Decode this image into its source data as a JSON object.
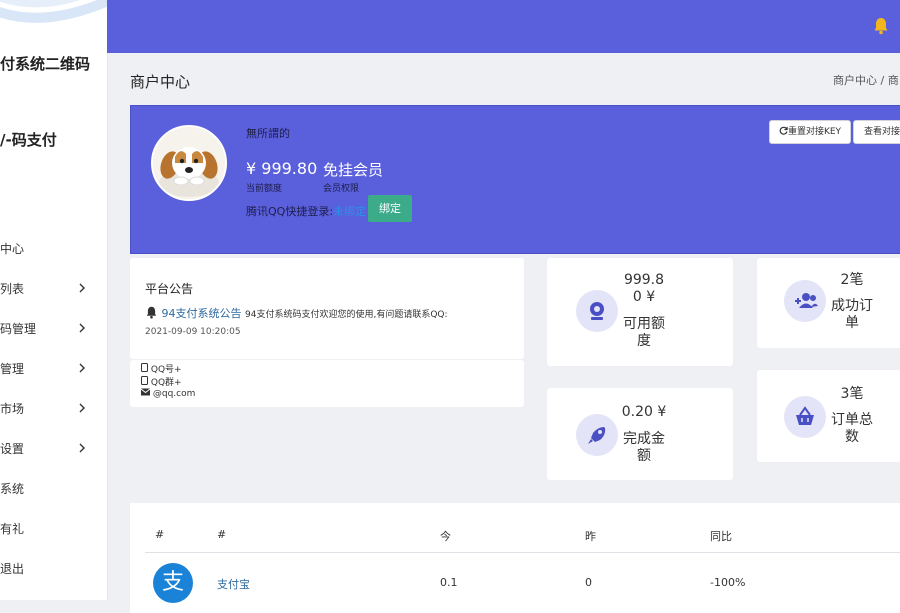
{
  "sidebar": {
    "brand_line1": "付系统二维码",
    "brand_line2": "/-码支付",
    "items": [
      {
        "label": "中心",
        "chevron": false
      },
      {
        "label": "列表",
        "chevron": true
      },
      {
        "label": "码管理",
        "chevron": true
      },
      {
        "label": "管理",
        "chevron": true
      },
      {
        "label": "市场",
        "chevron": true
      },
      {
        "label": "设置",
        "chevron": true
      },
      {
        "label": "系统",
        "chevron": false
      },
      {
        "label": "有礼",
        "chevron": false
      },
      {
        "label": "退出",
        "chevron": false
      }
    ]
  },
  "header": {
    "page_title": "商户中心",
    "breadcrumb": "商户中心  /  商"
  },
  "profile": {
    "name": "無所謂的",
    "balance": "¥ 999.80",
    "balance_label": "当前额度",
    "member": "免挂会员",
    "member_label": "会员权限",
    "qq_prefix": "腾讯QQ快捷登录:",
    "qq_status": "未绑定",
    "bind_button": "绑定",
    "reset_key_button": "重置对接KEY",
    "view_key_button": "查看对接"
  },
  "notice": {
    "title": "平台公告",
    "link_text": "94支付系统公告",
    "text": "94支付系统码支付欢迎您的使用,有问题请联系QQ:",
    "date": "2021-09-09 10:20:05"
  },
  "contact": {
    "qq": "QQ号+",
    "group": "QQ群+",
    "email": "@qq.com"
  },
  "stats": [
    {
      "value_line1": "999.8",
      "value_line2": "0 ¥",
      "label_line1": "可用额",
      "label_line2": "度",
      "icon": "webcam-icon"
    },
    {
      "value_line1": "2笔",
      "value_line2": "",
      "label_line1": "成功订",
      "label_line2": "单",
      "icon": "add-user-icon"
    },
    {
      "value_line1": "0.20 ¥",
      "value_line2": "",
      "label_line1": "完成金",
      "label_line2": "额",
      "icon": "rocket-icon"
    },
    {
      "value_line1": "3笔",
      "value_line2": "",
      "label_line1": "订单总",
      "label_line2": "数",
      "icon": "basket-icon"
    }
  ],
  "table": {
    "headers": [
      "#",
      "#",
      "今",
      "昨",
      "同比"
    ],
    "rows": [
      {
        "icon_text": "支",
        "name": "支付宝",
        "today": "0.1",
        "yesterday": "0",
        "ratio": "-100%"
      }
    ]
  },
  "colors": {
    "topbar": "#5a5fdc",
    "bind_button": "#3bab8a",
    "bell": "#f2b51b",
    "stat_icon_bg": "#e3e4f7",
    "stat_icon_fg": "#4a4fc4"
  }
}
